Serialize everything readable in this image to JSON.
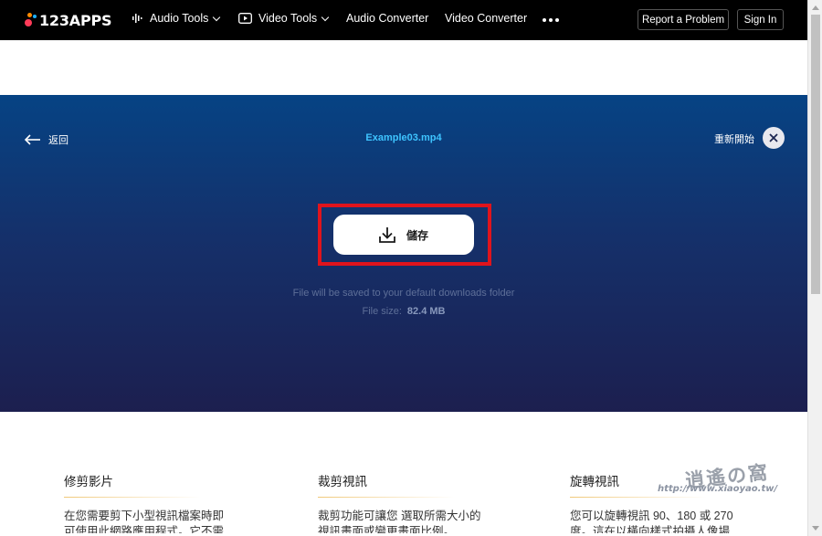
{
  "nav": {
    "brand": "123APPS",
    "audio_tools": "Audio Tools",
    "video_tools": "Video Tools",
    "audio_converter": "Audio Converter",
    "video_converter": "Video Converter",
    "report": "Report a Problem",
    "sign_in": "Sign In"
  },
  "hero": {
    "back_label": "返回",
    "filename": "Example03.mp4",
    "restart_label": "重新開始",
    "save_label": "儲存",
    "save_note": "File will be saved to your default downloads folder",
    "size_label": "File size:",
    "size_value": "82.4 MB"
  },
  "cards": [
    {
      "title": "修剪影片",
      "line1": "在您需要剪下小型視訊檔案時即",
      "line2": "可使用此網路應用程式。它不需"
    },
    {
      "title": "裁剪視訊",
      "line1": "裁剪功能可讓您 選取所需大小的",
      "line2": "視訊畫面或變更畫面比例。"
    },
    {
      "title": "旋轉視訊",
      "line1": "您可以旋轉視訊 90、180 或 270",
      "line2": "度。這在以橫向樣式拍攝人像場"
    }
  ],
  "watermark": {
    "title": "逍遙の窩",
    "url": "http://www.xiaoyao.tw/"
  },
  "colors": {
    "highlight": "#e0141c",
    "filename": "#3ec4ff",
    "hero_top": "#064384",
    "hero_bottom": "#1c1f4f"
  }
}
